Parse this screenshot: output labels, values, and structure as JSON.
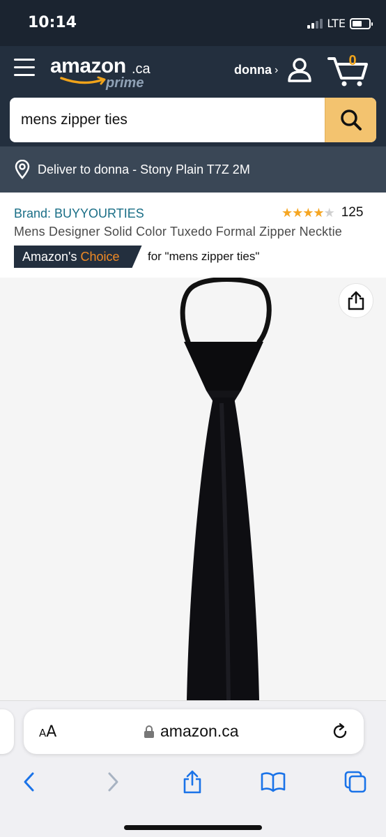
{
  "status_bar": {
    "time": "10:14",
    "network": "LTE",
    "signal_bars": 2,
    "battery_level": 0.6
  },
  "header": {
    "logo_text": "amazon",
    "logo_tld": ".ca",
    "logo_sub": "prime",
    "account_name": "donna",
    "account_chevron": "›",
    "cart_count": "0",
    "icons": [
      "menu-icon",
      "user-icon",
      "cart-icon"
    ]
  },
  "search": {
    "query": "mens zipper ties",
    "button_icon": "search-icon"
  },
  "delivery": {
    "text": "Deliver to donna - Stony Plain T7Z 2M",
    "icon": "location-pin-icon"
  },
  "product": {
    "brand": "Brand: BUYYOURTIES",
    "rating_stars": 4,
    "rating_out_of": 5,
    "rating_count": "125",
    "title": "Mens Designer Solid Color Tuxedo Formal Zipper Necktie",
    "badge_prefix": "Amazon's",
    "badge_highlight": "Choice",
    "badge_for": "for \"mens zipper ties\""
  },
  "browser": {
    "text_size_label_small": "A",
    "text_size_label_large": "A",
    "url": "amazon.ca",
    "icons": [
      "lock-icon",
      "reload-icon",
      "back-icon",
      "forward-icon",
      "share-icon",
      "bookmarks-icon",
      "tabs-icon"
    ]
  },
  "colors": {
    "header_bg": "#232f3e",
    "delivery_bg": "#3a4756",
    "search_button": "#f3c36f",
    "brand_link": "#1a6e86",
    "star": "#f5a623",
    "choice_orange": "#f08a24",
    "ios_blue": "#1a73e8"
  }
}
